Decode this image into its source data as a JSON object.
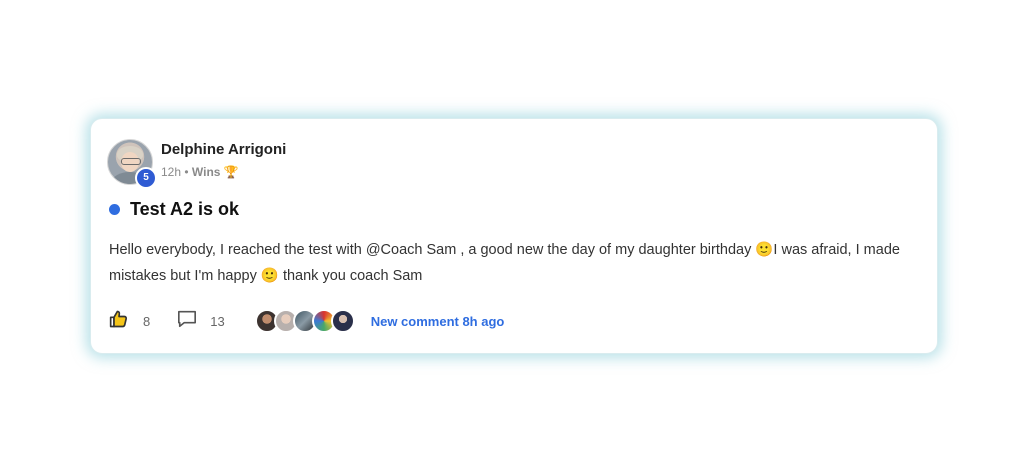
{
  "post": {
    "author": "Delphine Arrigoni",
    "author_level": "5",
    "time": "12h",
    "separator": "•",
    "category": "Wins",
    "category_icon": "🏆",
    "title": "Test A2 is ok",
    "body": "Hello everybody, I reached the test with @Coach Sam , a good new the day of my daughter birthday 🙂I was afraid, I made mistakes but I'm happy 🙂 thank you coach Sam",
    "likes": "8",
    "comments": "13",
    "participants": [
      "participant-avatar-1",
      "participant-avatar-2",
      "participant-avatar-3",
      "participant-avatar-4",
      "participant-avatar-5"
    ],
    "new_comment_label": "New comment 8h ago"
  },
  "icons": {
    "like": "thumbs-up-icon",
    "comment": "comment-bubble-icon"
  },
  "colors": {
    "accent": "#2f6de0",
    "badge": "#2f5bd3",
    "card_glow": "#7ec8d6"
  }
}
